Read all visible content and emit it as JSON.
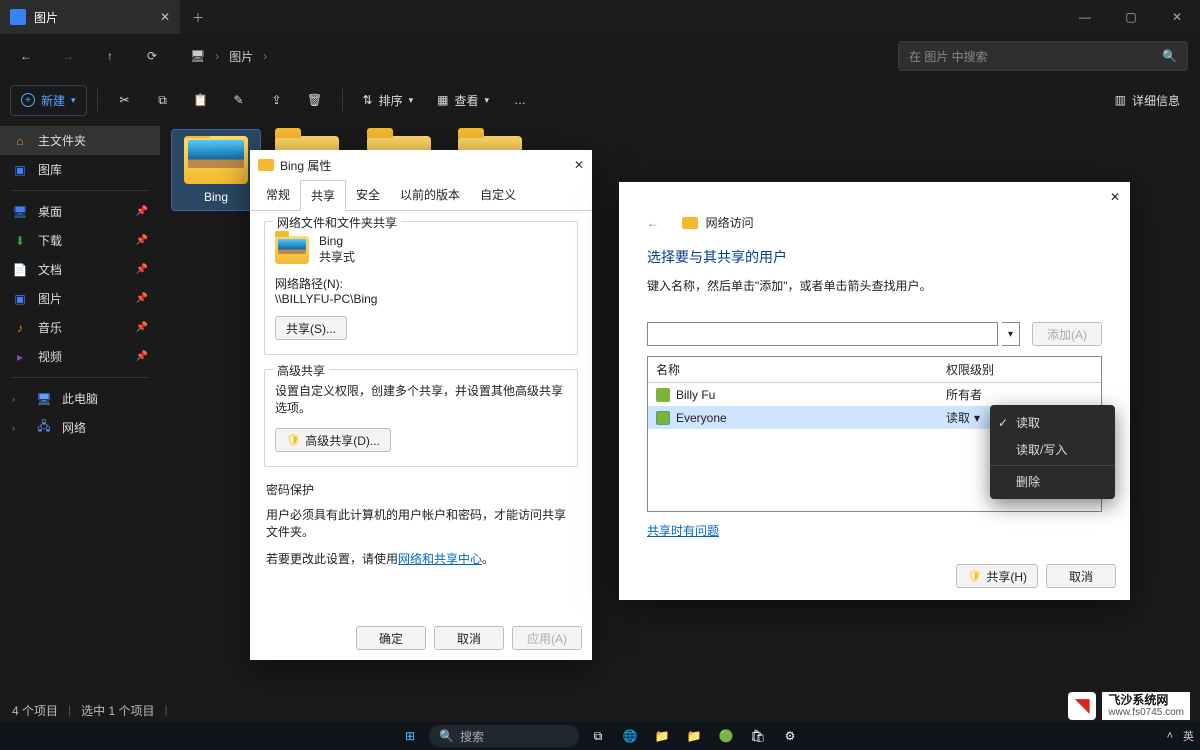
{
  "titlebar": {
    "tab_title": "图片"
  },
  "nav": {
    "breadcrumb_icon": "monitor",
    "breadcrumb": [
      "图片"
    ],
    "search_placeholder": "在 图片 中搜索"
  },
  "toolbar": {
    "new": "新建",
    "sort": "排序",
    "view": "查看",
    "details": "详细信息"
  },
  "sidebar": {
    "home": "主文件夹",
    "gallery": "图库",
    "quick": [
      {
        "label": "桌面"
      },
      {
        "label": "下载"
      },
      {
        "label": "文档"
      },
      {
        "label": "图片"
      },
      {
        "label": "音乐"
      },
      {
        "label": "视频"
      }
    ],
    "this_pc": "此电脑",
    "network": "网络"
  },
  "folders": [
    {
      "name": "Bing"
    }
  ],
  "statusbar": {
    "count": "4 个项目",
    "selection": "选中 1 个项目"
  },
  "properties": {
    "title": "Bing 属性",
    "tabs": [
      "常规",
      "共享",
      "安全",
      "以前的版本",
      "自定义"
    ],
    "active_tab": 1,
    "net_share_group": "网络文件和文件夹共享",
    "folder_name": "Bing",
    "share_state": "共享式",
    "path_label": "网络路径(N):",
    "path_value": "\\\\BILLYFU-PC\\Bing",
    "share_btn": "共享(S)...",
    "adv_group": "高级共享",
    "adv_desc": "设置自定义权限，创建多个共享，并设置其他高级共享选项。",
    "adv_btn": "高级共享(D)...",
    "pwd_group": "密码保护",
    "pwd_line1": "用户必须具有此计算机的用户帐户和密码，才能访问共享文件夹。",
    "pwd_line2_prefix": "若要更改此设置，请使用",
    "pwd_link": "网络和共享中心",
    "ok": "确定",
    "cancel": "取消",
    "apply": "应用(A)"
  },
  "net_access": {
    "header": "网络访问",
    "h2": "选择要与其共享的用户",
    "hint": "键入名称，然后单击\"添加\"，或者单击箭头查找用户。",
    "add": "添加(A)",
    "col_name": "名称",
    "col_perm": "权限级别",
    "rows": [
      {
        "name": "Billy Fu",
        "perm": "所有者"
      },
      {
        "name": "Everyone",
        "perm": "读取"
      }
    ],
    "share_issue": "共享时有问题",
    "share": "共享(H)",
    "cancel": "取消"
  },
  "perm_menu": {
    "items": [
      "读取",
      "读取/写入",
      "删除"
    ],
    "checked": 0
  },
  "taskbar": {
    "search": "搜索",
    "ime": "英"
  },
  "watermark": {
    "line1": "飞沙系统网",
    "line2": "www.fs0745.com"
  }
}
